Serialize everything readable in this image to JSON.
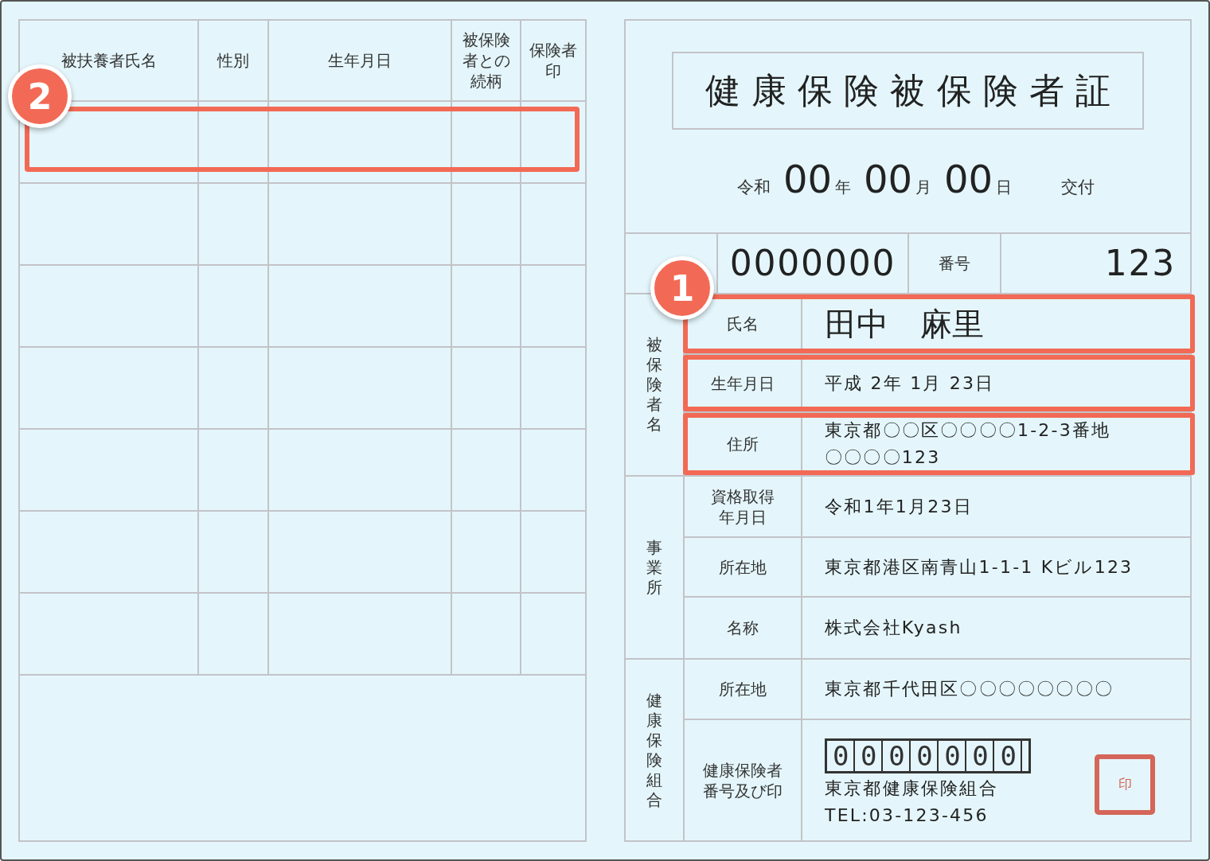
{
  "dependents_table": {
    "columns": [
      "被扶養者氏名",
      "性別",
      "生年月日",
      "被保険者との続柄",
      "保険者印"
    ],
    "highlight": {
      "badge": "2"
    }
  },
  "card": {
    "title": "健康保険被保険者証",
    "issue_date": {
      "era": "令和",
      "year": "00",
      "year_unit": "年",
      "month": "00",
      "month_unit": "月",
      "day": "00",
      "day_unit": "日",
      "label": "交付"
    },
    "number_row": {
      "symbol_value": "0000000",
      "number_label": "番号",
      "number_value": "123"
    },
    "sections": [
      {
        "group": "被保険者名",
        "badge": "1",
        "rows": [
          {
            "kind": "large",
            "label": [
              "氏名"
            ],
            "value": [
              "田中　麻里"
            ],
            "highlighted": true
          },
          {
            "kind": "text",
            "label": [
              "生年月日"
            ],
            "value": [
              "平成 2年 1月 23日"
            ],
            "highlighted": true
          },
          {
            "kind": "text",
            "label": [
              "住所"
            ],
            "value": [
              "東京都〇〇区〇〇〇〇1-2-3番地",
              "〇〇〇〇123"
            ],
            "highlighted": true
          }
        ]
      },
      {
        "group": "事業所",
        "rows": [
          {
            "kind": "text",
            "label": [
              "資格取得",
              "年月日"
            ],
            "value": [
              "令和1年1月23日"
            ],
            "highlighted": false
          },
          {
            "kind": "text",
            "label": [
              "所在地"
            ],
            "value": [
              "東京都港区南青山1-1-1 Kビル123"
            ],
            "highlighted": false
          },
          {
            "kind": "text",
            "label": [
              "名称"
            ],
            "value": [
              "株式会社Kyash"
            ],
            "highlighted": false
          }
        ]
      },
      {
        "group": "健康保険組合",
        "rows": [
          {
            "kind": "text",
            "label": [
              "所在地"
            ],
            "value": [
              "東京都千代田区〇〇〇〇〇〇〇〇"
            ],
            "highlighted": false
          },
          {
            "kind": "insurer",
            "label": [
              "健康保険者",
              "番号及び印"
            ],
            "code": "0000000",
            "name": "東京都健康保険組合",
            "tel": "TEL:03-123-456",
            "stamp": "印",
            "highlighted": false
          }
        ]
      }
    ]
  }
}
